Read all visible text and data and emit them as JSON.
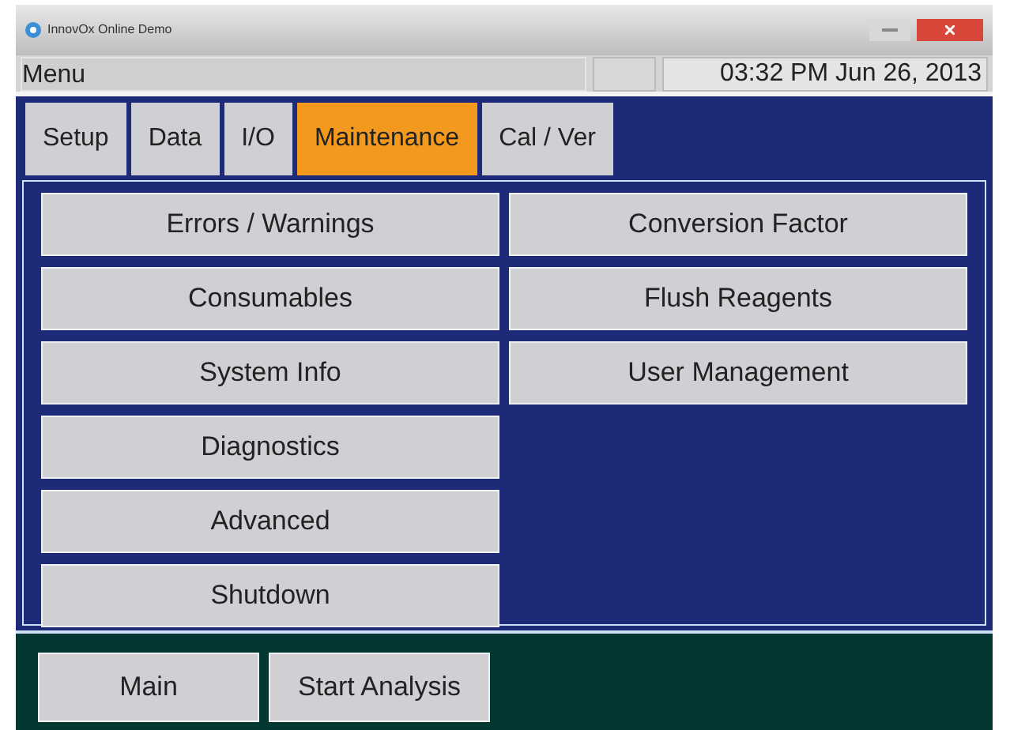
{
  "window": {
    "title": "InnovOx Online Demo"
  },
  "menu_bar": {
    "label": "Menu",
    "clock": "03:32 PM Jun 26, 2013"
  },
  "tabs": [
    {
      "label": "Setup",
      "selected": false
    },
    {
      "label": "Data",
      "selected": false
    },
    {
      "label": "I/O",
      "selected": false
    },
    {
      "label": "Maintenance",
      "selected": true
    },
    {
      "label": "Cal / Ver",
      "selected": false
    }
  ],
  "left_buttons": [
    "Errors / Warnings",
    "Consumables",
    "System Info",
    "Diagnostics",
    "Advanced",
    "Shutdown"
  ],
  "right_buttons": [
    "Conversion Factor",
    "Flush Reagents",
    "User Management"
  ],
  "footer_buttons": [
    "Main",
    "Start Analysis"
  ]
}
